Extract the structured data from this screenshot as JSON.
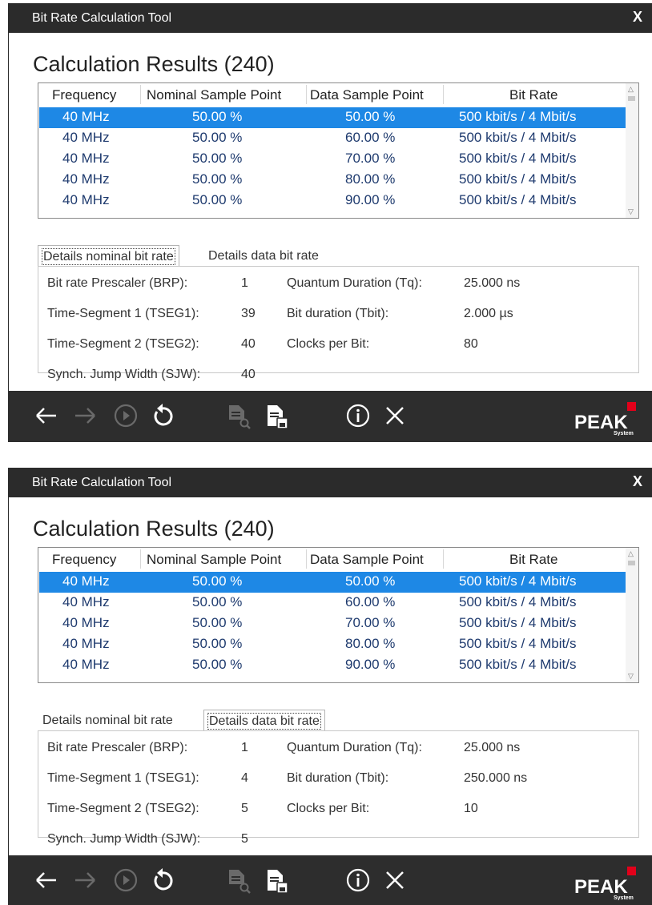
{
  "windows": [
    {
      "title": "Bit Rate Calculation Tool",
      "close_label": "X",
      "heading": "Calculation Results (240)",
      "columns": [
        "Frequency",
        "Nominal Sample Point",
        "Data Sample Point",
        "Bit Rate"
      ],
      "rows": [
        [
          "40 MHz",
          "50.00 %",
          "50.00 %",
          "500 kbit/s / 4 Mbit/s"
        ],
        [
          "40 MHz",
          "50.00 %",
          "60.00 %",
          "500 kbit/s / 4 Mbit/s"
        ],
        [
          "40 MHz",
          "50.00 %",
          "70.00 %",
          "500 kbit/s / 4 Mbit/s"
        ],
        [
          "40 MHz",
          "50.00 %",
          "80.00 %",
          "500 kbit/s / 4 Mbit/s"
        ],
        [
          "40 MHz",
          "50.00 %",
          "90.00 %",
          "500 kbit/s / 4 Mbit/s"
        ]
      ],
      "selected_row": 0,
      "tabs": [
        "Details nominal bit rate",
        "Details data bit rate"
      ],
      "active_tab": 0,
      "details": {
        "left": [
          {
            "label": "Bit rate Prescaler (BRP):",
            "value": "1"
          },
          {
            "label": "Time-Segment 1 (TSEG1):",
            "value": "39"
          },
          {
            "label": "Time-Segment 2 (TSEG2):",
            "value": "40"
          },
          {
            "label": "Synch. Jump Width (SJW):",
            "value": "40"
          }
        ],
        "right": [
          {
            "label": "Quantum Duration (Tq):",
            "value": "25.000 ns"
          },
          {
            "label": "Bit duration (Tbit):",
            "value": "2.000 µs"
          },
          {
            "label": "Clocks per Bit:",
            "value": "80"
          }
        ]
      }
    },
    {
      "title": "Bit Rate Calculation Tool",
      "close_label": "X",
      "heading": "Calculation Results (240)",
      "columns": [
        "Frequency",
        "Nominal Sample Point",
        "Data Sample Point",
        "Bit Rate"
      ],
      "rows": [
        [
          "40 MHz",
          "50.00 %",
          "50.00 %",
          "500 kbit/s / 4 Mbit/s"
        ],
        [
          "40 MHz",
          "50.00 %",
          "60.00 %",
          "500 kbit/s / 4 Mbit/s"
        ],
        [
          "40 MHz",
          "50.00 %",
          "70.00 %",
          "500 kbit/s / 4 Mbit/s"
        ],
        [
          "40 MHz",
          "50.00 %",
          "80.00 %",
          "500 kbit/s / 4 Mbit/s"
        ],
        [
          "40 MHz",
          "50.00 %",
          "90.00 %",
          "500 kbit/s / 4 Mbit/s"
        ]
      ],
      "selected_row": 0,
      "tabs": [
        "Details nominal bit rate",
        "Details data bit rate"
      ],
      "active_tab": 1,
      "details": {
        "left": [
          {
            "label": "Bit rate Prescaler (BRP):",
            "value": "1"
          },
          {
            "label": "Time-Segment 1 (TSEG1):",
            "value": "4"
          },
          {
            "label": "Time-Segment 2 (TSEG2):",
            "value": "5"
          },
          {
            "label": "Synch. Jump Width (SJW):",
            "value": "5"
          }
        ],
        "right": [
          {
            "label": "Quantum Duration (Tq):",
            "value": "25.000 ns"
          },
          {
            "label": "Bit duration (Tbit):",
            "value": "250.000 ns"
          },
          {
            "label": "Clocks per Bit:",
            "value": "10"
          }
        ]
      }
    }
  ],
  "footer_icons": [
    "back-arrow-icon",
    "forward-arrow-icon",
    "play-circle-icon",
    "reset-icon",
    "document-search-icon",
    "document-save-icon",
    "info-icon",
    "close-x-icon"
  ],
  "logo_text": "PEAK",
  "logo_subtext": "System",
  "colors": {
    "titlebar": "#2b2b2b",
    "footer": "#2d2d2d",
    "selection": "#1e88e5",
    "row_text": "#1e3a6e",
    "logo_accent": "#e2001a"
  }
}
